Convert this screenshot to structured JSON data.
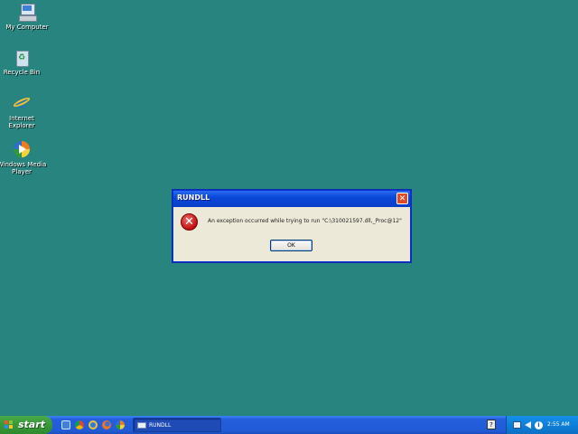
{
  "desktop": {
    "icons": [
      {
        "label_line1": "My Computer",
        "label_line2": "",
        "icon": "my-computer-icon"
      },
      {
        "label_line1": "Recycle Bin",
        "label_line2": "",
        "icon": "recycle-bin-icon"
      },
      {
        "label_line1": "Internet",
        "label_line2": "Explorer",
        "icon": "internet-explorer-icon"
      },
      {
        "label_line1": "Windows Media",
        "label_line2": "Player",
        "icon": "windows-media-player-icon"
      }
    ],
    "background_color": "#27847e"
  },
  "dialog": {
    "title": "RUNDLL",
    "close_glyph": "✕",
    "error_glyph": "✕",
    "message": "An exception occurred while trying to run \"C:\\310021597.dll,_Proc@12\"",
    "ok_label": "OK",
    "icon": "error-icon"
  },
  "taskbar": {
    "start_label": "start",
    "quick_launch": [
      {
        "icon": "show-desktop-icon",
        "color": "#3e7fe0"
      },
      {
        "icon": "chrome-icon",
        "color": "#e8b53a"
      },
      {
        "icon": "internet-explorer-icon",
        "color": "#2f7ae0"
      },
      {
        "icon": "firefox-icon",
        "color": "#e8742a"
      },
      {
        "icon": "windows-media-player-icon",
        "color": "#f0a02e"
      }
    ],
    "task_button_label": "RUNDLL",
    "help_glyph": "?",
    "tray_icons": [
      "network-icon",
      "speaker-icon",
      "info-icon"
    ],
    "info_glyph": "i",
    "clock": "2:55 AM"
  },
  "colors": {
    "titlebar": "#0a48d8",
    "taskbar": "#245edb",
    "start_button": "#3a9b3a",
    "tray": "#0f7fd8",
    "close_button": "#e04a2b",
    "error_red": "#c01010"
  }
}
